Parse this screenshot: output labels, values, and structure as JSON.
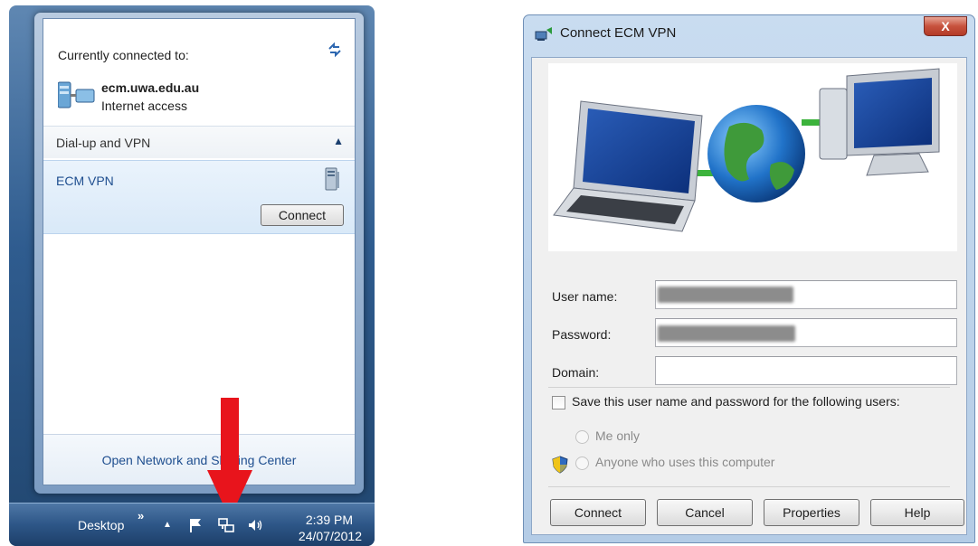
{
  "flyout": {
    "title": "Currently connected to:",
    "refresh_icon": "refresh-arrows-icon",
    "network": {
      "icon": "network-connection-icon",
      "name": "ecm.uwa.edu.au",
      "status": "Internet access"
    },
    "section": {
      "label": "Dial-up and VPN",
      "collapse_icon": "chevron-up-icon"
    },
    "vpn": {
      "name": "ECM VPN",
      "icon": "vpn-connection-icon",
      "connect_label": "Connect"
    },
    "footer_link": "Open Network and Sharing Center"
  },
  "taskbar": {
    "desktop_label": "Desktop",
    "more_label": "»",
    "tray_arrow": "▲",
    "icons": [
      "action-center-flag-icon",
      "network-tray-icon",
      "volume-icon"
    ],
    "time": "2:39 PM",
    "date": "24/07/2012",
    "highlight_color": "#e8141c"
  },
  "dialog": {
    "title": "Connect ECM VPN",
    "close_label": "X",
    "fields": {
      "username_label": "User name:",
      "password_label": "Password:",
      "domain_label": "Domain:",
      "domain_value": ""
    },
    "save_label": "Save this user name and password for the following users:",
    "save_checked": false,
    "radio_me_only": "Me only",
    "radio_anyone": "Anyone who uses this computer",
    "buttons": {
      "connect": "Connect",
      "cancel": "Cancel",
      "properties": "Properties",
      "help": "Help"
    }
  }
}
